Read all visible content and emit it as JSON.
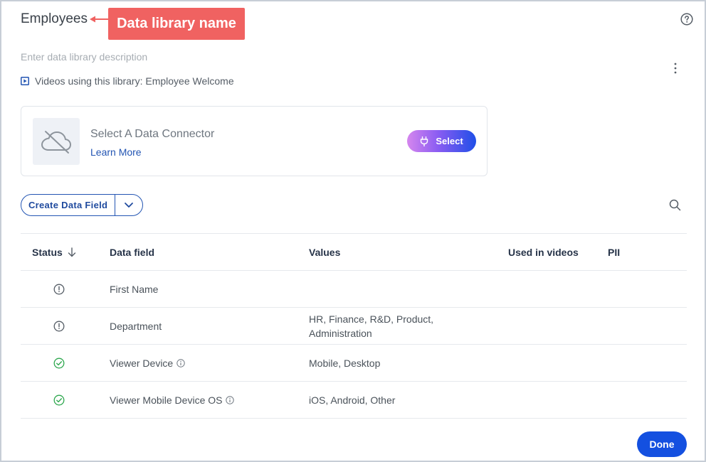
{
  "header": {
    "title": "Employees",
    "callout": "Data library name",
    "description_placeholder": "Enter data library description",
    "videos_text": "Videos using this library: Employee Welcome"
  },
  "connector": {
    "title": "Select A Data Connector",
    "learn_more": "Learn More",
    "select_label": "Select"
  },
  "toolbar": {
    "create_label": "Create Data Field"
  },
  "table": {
    "columns": [
      "Status",
      "Data field",
      "Values",
      "Used in videos",
      "PII"
    ],
    "rows": [
      {
        "status": "warning",
        "field": "First Name",
        "values": ""
      },
      {
        "status": "warning",
        "field": "Department",
        "values": "HR, Finance, R&D, Product, Administration"
      },
      {
        "status": "ok",
        "field": "Viewer Device",
        "values": "Mobile, Desktop",
        "info": true
      },
      {
        "status": "ok",
        "field": "Viewer Mobile Device OS",
        "values": "iOS, Android, Other",
        "info": true
      }
    ]
  },
  "footer": {
    "done_label": "Done"
  },
  "colors": {
    "accent": "#1450e0",
    "callout": "#f06261",
    "ok": "#2fa84f",
    "warning": "#555d66"
  }
}
